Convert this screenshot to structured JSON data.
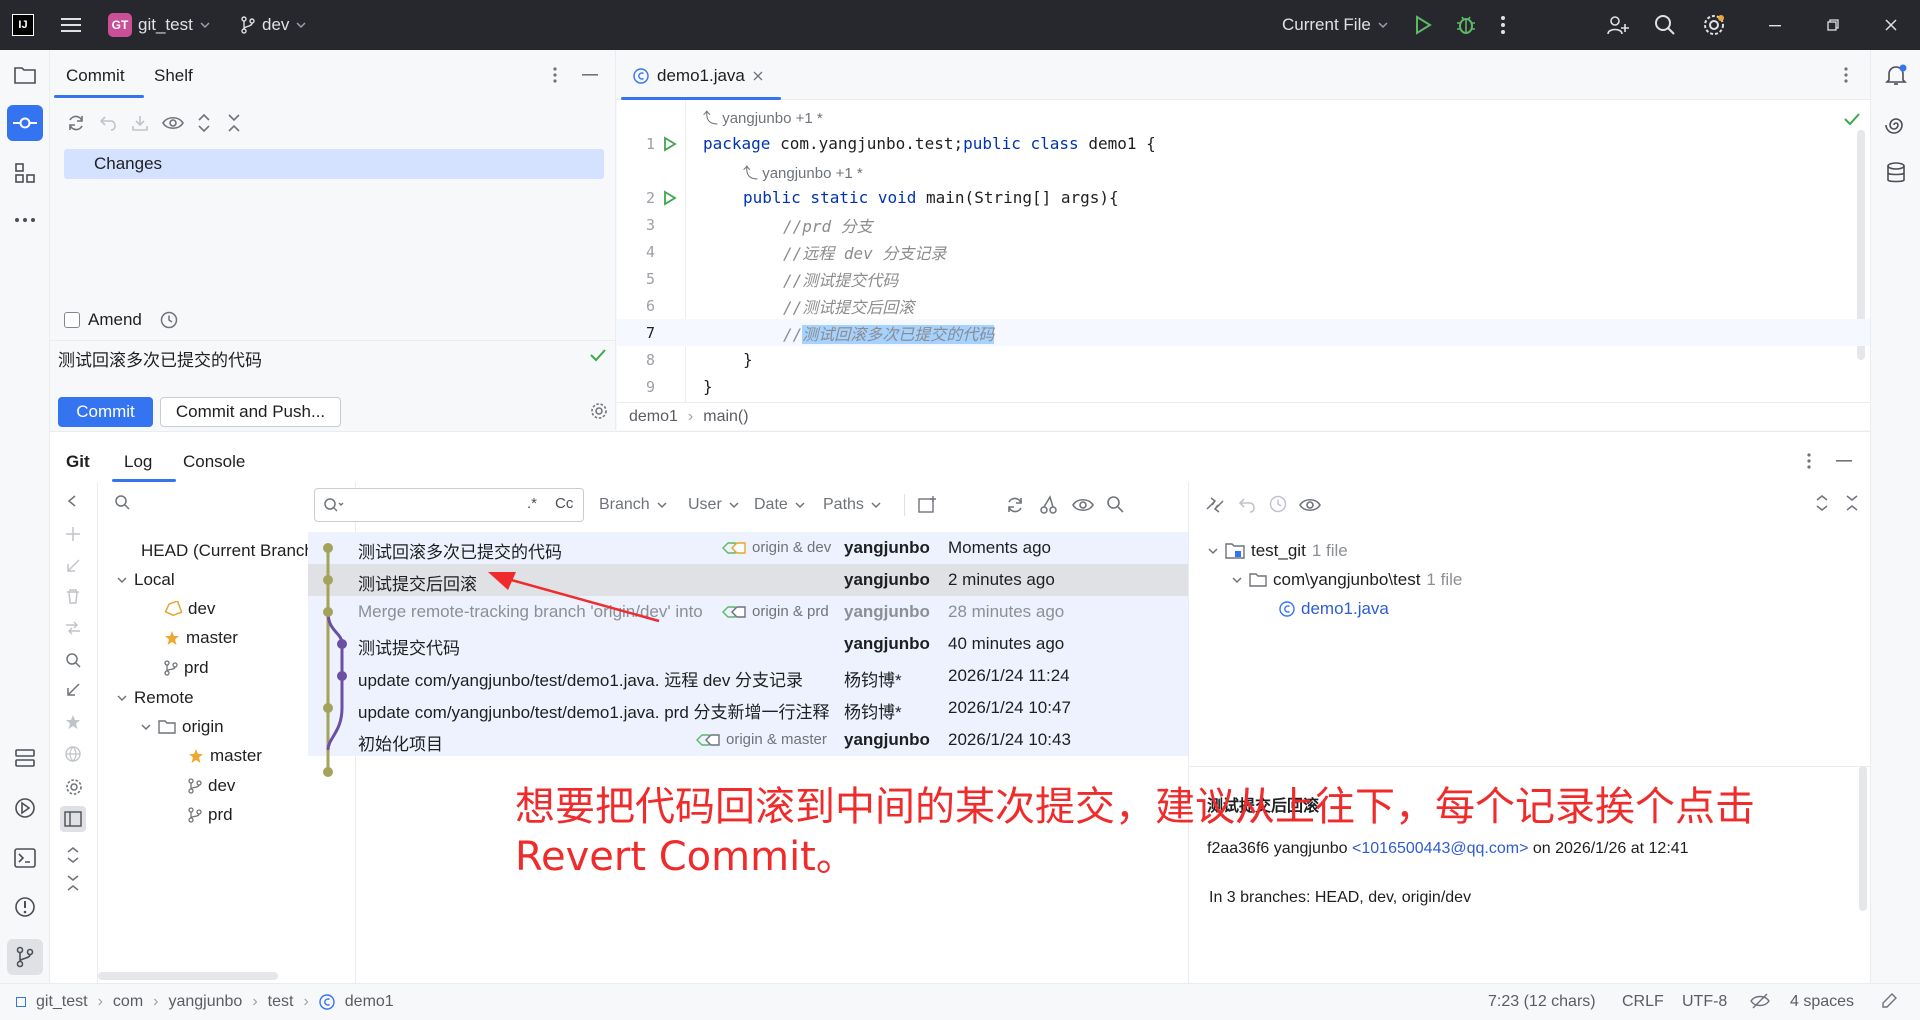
{
  "titlebar": {
    "app_icon": "intellij-icon",
    "project_badge": "GT",
    "project_name": "git_test",
    "branch": "dev",
    "run_config": "Current File"
  },
  "commit_panel": {
    "tabs": [
      "Commit",
      "Shelf"
    ],
    "changes_label": "Changes",
    "amend_label": "Amend",
    "message": "测试回滚多次已提交的代码",
    "commit_btn": "Commit",
    "commit_push_btn": "Commit and Push..."
  },
  "editor": {
    "tab_name": "demo1.java",
    "author_hint": "yangjunbo +1 *",
    "lines": [
      {
        "n": "1",
        "text": "package com.yangjunbo.test;public class demo1 {"
      },
      {
        "n": "2",
        "text": "public static void main(String[] args){"
      },
      {
        "n": "3",
        "text": "//prd 分支"
      },
      {
        "n": "4",
        "text": "//远程 dev 分支记录"
      },
      {
        "n": "5",
        "text": "//测试提交代码"
      },
      {
        "n": "6",
        "text": "//测试提交后回滚"
      },
      {
        "n": "7",
        "text": "//测试回滚多次已提交的代码"
      },
      {
        "n": "8",
        "text": "}"
      },
      {
        "n": "9",
        "text": "}"
      }
    ],
    "breadcrumb": [
      "demo1",
      "main()"
    ]
  },
  "git_panel": {
    "tabs": [
      "Git",
      "Log",
      "Console"
    ],
    "branches": {
      "head": "HEAD (Current Branch)",
      "local_label": "Local",
      "local": [
        "dev",
        "master",
        "prd"
      ],
      "remote_label": "Remote",
      "origin_label": "origin",
      "remote": [
        "master",
        "dev",
        "prd"
      ]
    },
    "filters": [
      "Branch",
      "User",
      "Date",
      "Paths"
    ],
    "search_regex": ".*",
    "search_case": "Cc",
    "commits": [
      {
        "msg": "测试回滚多次已提交的代码",
        "refs": "origin & dev",
        "user": "yangjunbo",
        "date": "Moments ago"
      },
      {
        "msg": "测试提交后回滚",
        "refs": "",
        "user": "yangjunbo",
        "date": "2 minutes ago"
      },
      {
        "msg": "Merge remote-tracking branch 'origin/dev' into",
        "refs": "origin & prd",
        "user": "yangjunbo",
        "date": "28 minutes ago"
      },
      {
        "msg": "测试提交代码",
        "refs": "",
        "user": "yangjunbo",
        "date": "40 minutes ago"
      },
      {
        "msg": "update com/yangjunbo/test/demo1.java. 远程 dev 分支记录",
        "refs": "",
        "user": "杨钧博*",
        "date": "2026/1/24 11:24"
      },
      {
        "msg": "update com/yangjunbo/test/demo1.java. prd 分支新增一行注释",
        "refs": "",
        "user": "杨钧博*",
        "date": "2026/1/24 10:47"
      },
      {
        "msg": "初始化项目",
        "refs": "origin & master",
        "user": "yangjunbo",
        "date": "2026/1/24 10:43"
      }
    ],
    "detail": {
      "root": "test_git",
      "root_count": "1 file",
      "folder": "com\\yangjunbo\\test",
      "folder_count": "1 file",
      "file": "demo1.java",
      "commit_title": "测试提交后回滚",
      "hash_author": "f2aa36f6 yangjunbo",
      "email": "<1016500443@qq.com>",
      "on_date": "on 2026/1/26 at 12:41",
      "branches": "In 3 branches: HEAD, dev, origin/dev"
    }
  },
  "annotation": {
    "line1": "想要把代码回滚到中间的某次提交，建议从上往下，每个记录挨个点击",
    "line2": "Revert Commit。"
  },
  "statusbar": {
    "path": [
      "git_test",
      "com",
      "yangjunbo",
      "test",
      "demo1"
    ],
    "position": "7:23 (12 chars)",
    "line_sep": "CRLF",
    "encoding": "UTF-8",
    "indent": "4 spaces"
  }
}
